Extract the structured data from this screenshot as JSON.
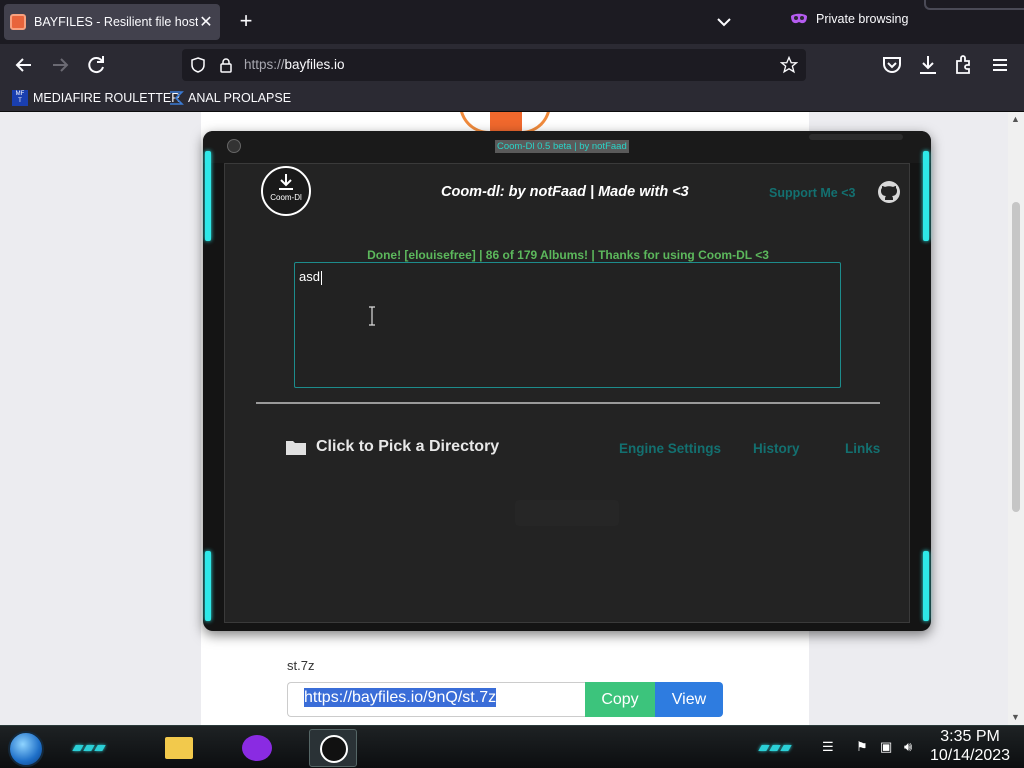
{
  "browser": {
    "tab_title": "BAYFILES - Resilient file hosting",
    "tab_close": "✕",
    "new_tab": "+",
    "private_label": "Private browsing",
    "url_proto": "https://",
    "url_host": "bayfiles.io",
    "bookmarks": [
      {
        "label": "MEDIAFIRE ROULETTER",
        "icon": "mediafire-icon"
      },
      {
        "label": "ANAL PROLAPSE",
        "icon": "sigma-icon"
      }
    ]
  },
  "page": {
    "file_name": "st.7z",
    "link_value": "https://bayfiles.io/9nQ/st.7z",
    "copy_label": "Copy",
    "view_label": "View"
  },
  "coom": {
    "window_title": "Coom-Dl 0.5 beta | by notFaad",
    "logo_text": "Coom-Dl",
    "header": "Coom-dl:  by notFaad  |  Made with <3",
    "support": "Support Me <3",
    "status": "Done! [elouisefree] | 86 of 179 Albums! | Thanks for using Coom-DL <3",
    "input_value": "asd",
    "pick_dir": "Click to Pick a Directory",
    "links": [
      "Engine Settings",
      "History",
      "Links"
    ],
    "accent": "#2ee8e8",
    "status_color": "#5cb85c"
  },
  "taskbar": {
    "time": "3:35 PM",
    "date": "10/14/2023"
  }
}
